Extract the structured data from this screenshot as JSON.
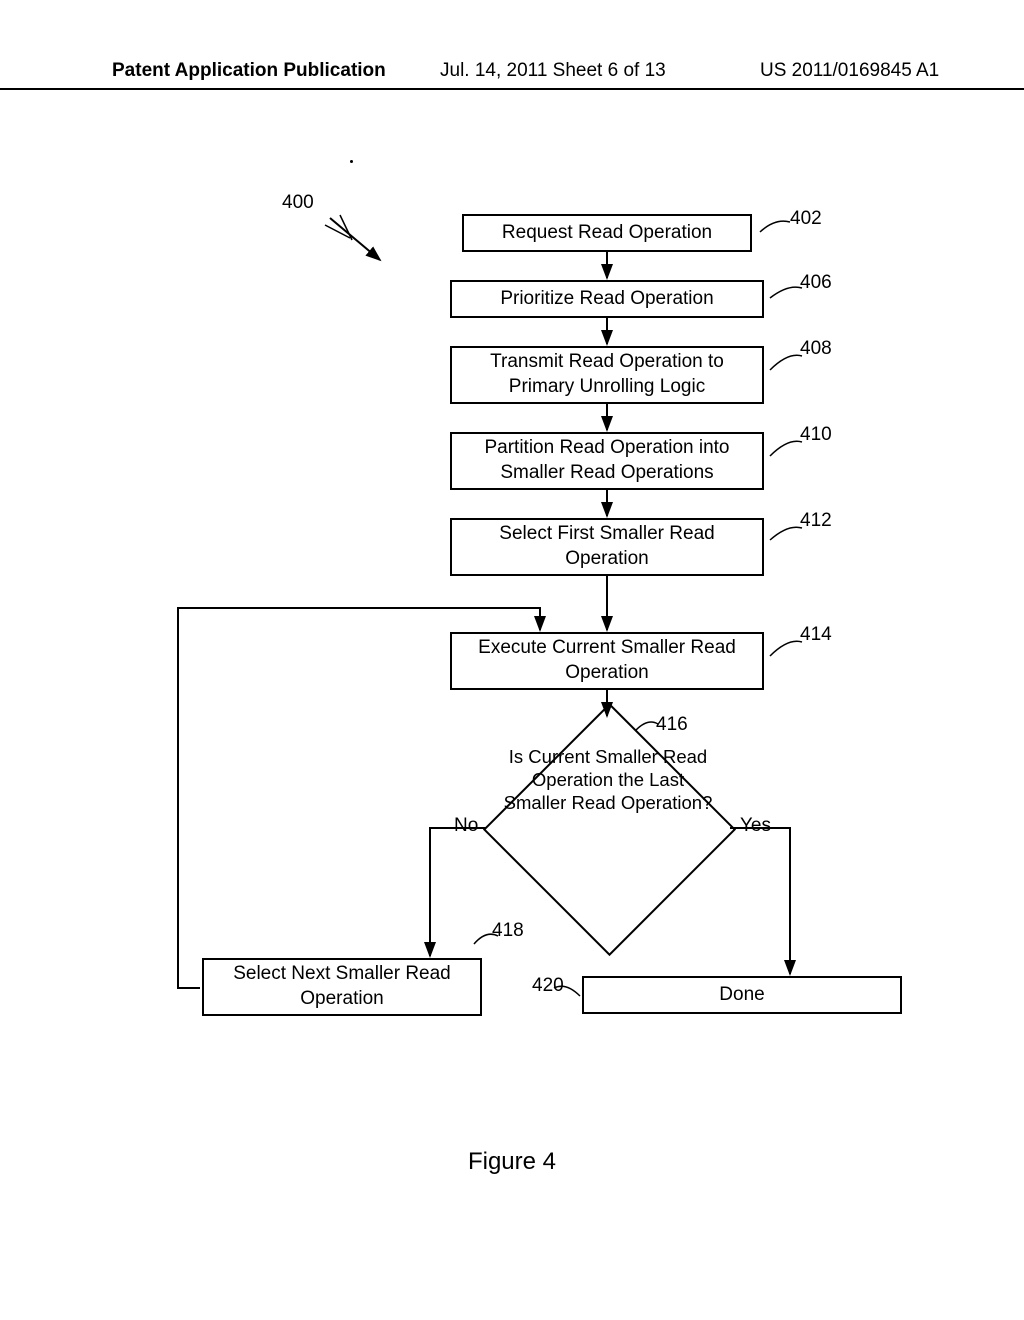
{
  "header": {
    "left": "Patent Application Publication",
    "mid": "Jul. 14, 2011  Sheet 6 of 13",
    "right": "US 2011/0169845 A1"
  },
  "refs": {
    "main": "400",
    "b402": "402",
    "b406": "406",
    "b408": "408",
    "b410": "410",
    "b412": "412",
    "b414": "414",
    "b416": "416",
    "b418": "418",
    "b420": "420"
  },
  "boxes": {
    "request": "Request Read Operation",
    "prioritize": "Prioritize Read Operation",
    "transmit": "Transmit Read Operation to Primary Unrolling Logic",
    "partition": "Partition Read Operation into Smaller Read Operations",
    "selectFirst": "Select First Smaller Read Operation",
    "execute": "Execute Current Smaller Read Operation",
    "decision": "Is Current Smaller Read Operation the Last Smaller Read Operation?",
    "selectNext": "Select Next Smaller Read Operation",
    "done": "Done"
  },
  "labels": {
    "no": "No",
    "yes": "Yes"
  },
  "caption": "Figure 4"
}
